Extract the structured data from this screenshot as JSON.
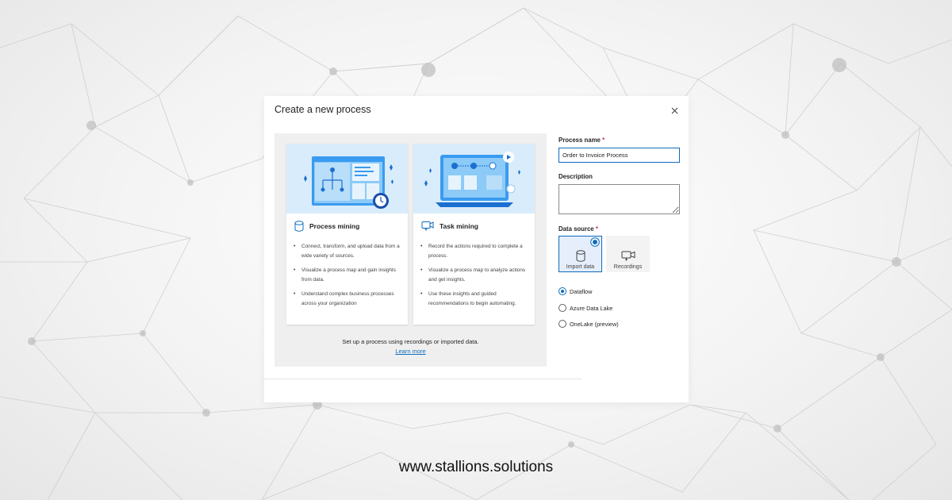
{
  "dialog": {
    "title": "Create a new process",
    "close_icon": "close-icon"
  },
  "options": {
    "process_mining": {
      "title": "Process mining",
      "icon": "database-icon",
      "bullets": [
        "Connect, transform, and upload data from a wide variety of sources.",
        "Visualize a process map and gain insights from data.",
        "Understand complex business processes across your organization"
      ]
    },
    "task_mining": {
      "title": "Task mining",
      "icon": "screen-recording-icon",
      "bullets": [
        "Record the actions required to complete a process.",
        "Visualize a process map to analyze actions and get insights.",
        "Use these insights and guided recommendations to begin automating."
      ]
    },
    "note": "Set up a process using recordings or imported data.",
    "learn_more": "Learn more"
  },
  "form": {
    "name_label": "Process name",
    "required_mark": "*",
    "name_value": "Order to Invoice Process",
    "description_label": "Description",
    "description_value": "",
    "source_label": "Data source",
    "tiles": [
      {
        "label": "Import data",
        "icon": "database-icon",
        "selected": true
      },
      {
        "label": "Recordings",
        "icon": "screen-recording-icon",
        "selected": false
      }
    ],
    "radios": [
      {
        "label": "Dataflow",
        "checked": true
      },
      {
        "label": "Azure Data Lake",
        "checked": false
      },
      {
        "label": "OneLake (preview)",
        "checked": false
      }
    ]
  },
  "footer": {
    "url": "www.stallions.solutions"
  },
  "colors": {
    "accent": "#0f6cbd",
    "required": "#c4314b",
    "illustration_bg": "#d9ecfb",
    "panel_bg": "#efefef"
  }
}
